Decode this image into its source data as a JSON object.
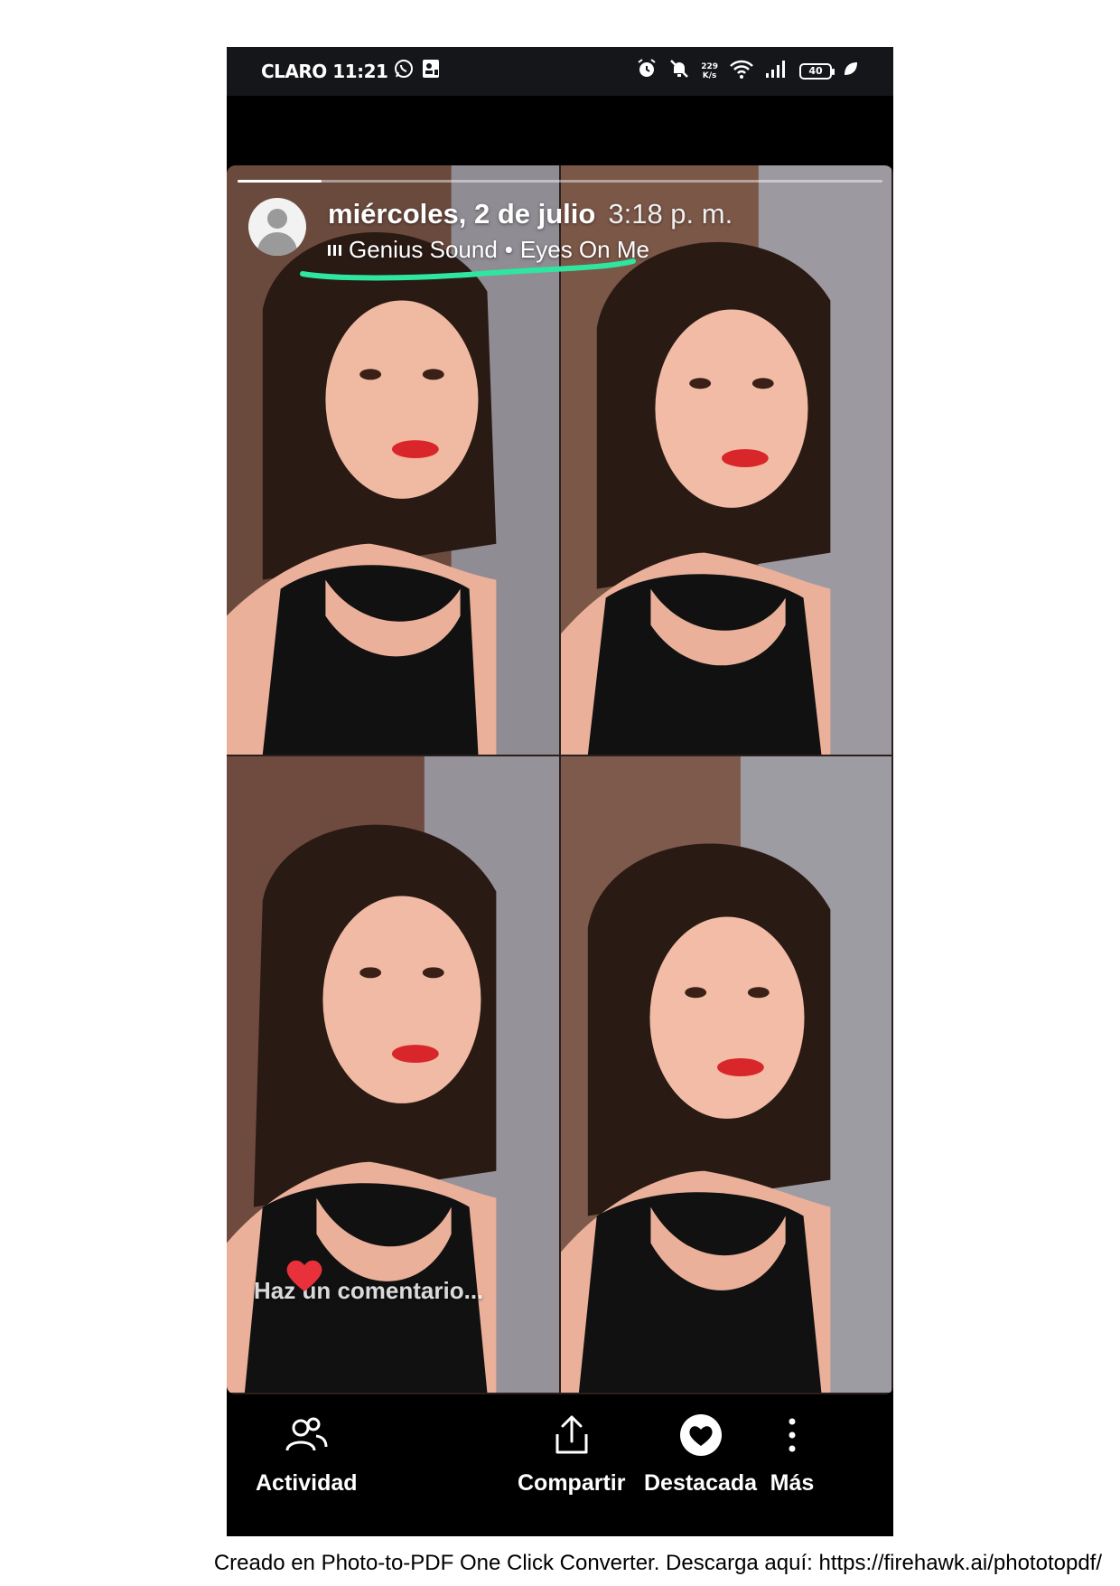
{
  "status_bar": {
    "carrier_time": "CLARO 11:21",
    "net_speed_value": "229",
    "net_speed_unit": "K/s",
    "battery": "40",
    "icons": [
      "whatsapp-icon",
      "contact-card-icon",
      "alarm-icon",
      "mute-icon",
      "wifi-icon",
      "signal-icon",
      "battery-icon",
      "leaf-icon"
    ]
  },
  "story": {
    "progress": 0.13,
    "date": "miércoles, 2 de julio",
    "time": "3:18 p. m.",
    "music": {
      "artist": "Genius Sound",
      "separator": "•",
      "song": "Eyes On Me"
    },
    "highlight_color": "#2ee6a0",
    "comment_placeholder": "Haz un comentario..."
  },
  "bottom_bar": {
    "activity_label": "Actividad",
    "share_label": "Compartir",
    "featured_label": "Destacada",
    "more_label": "Más"
  },
  "footer": {
    "note": "Creado en Photo-to-PDF One Click Converter. Descarga aquí: https://firehawk.ai/phototopdf/"
  }
}
